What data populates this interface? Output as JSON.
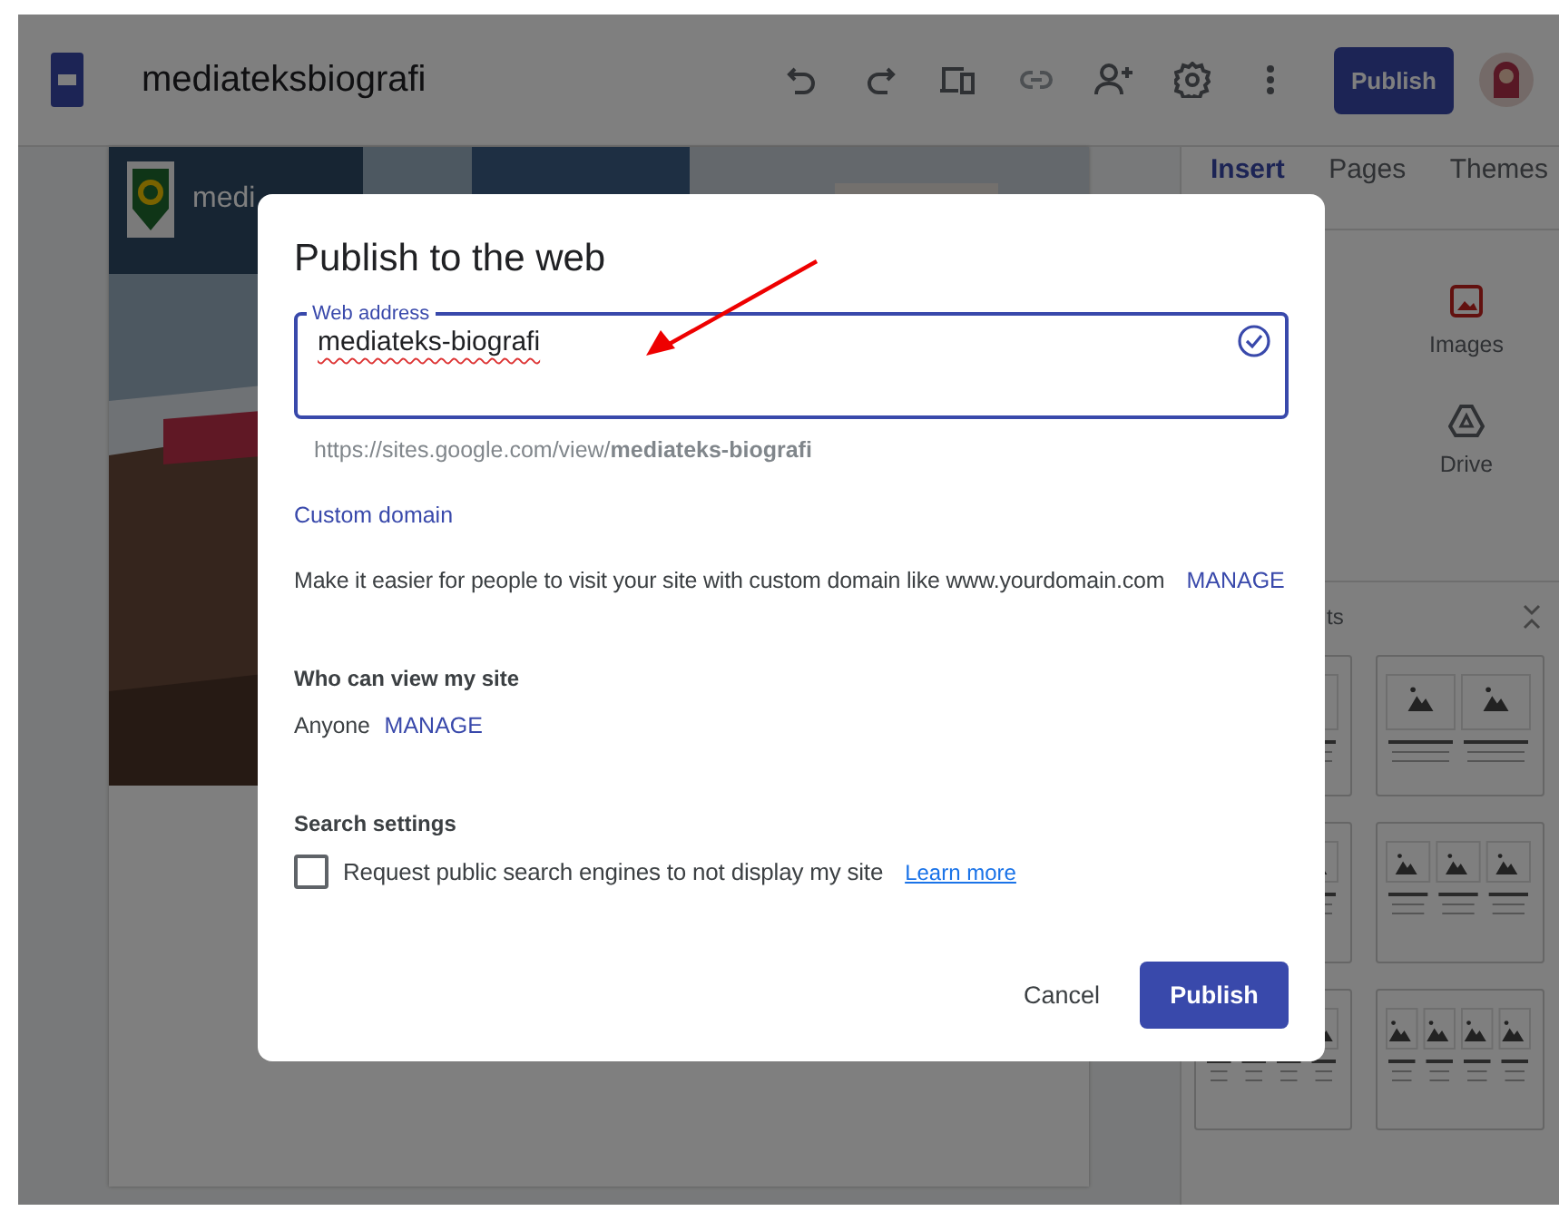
{
  "app": {
    "title": "mediateksbiografi",
    "publish_button": "Publish"
  },
  "site": {
    "title": "medi"
  },
  "sidebar": {
    "tabs": [
      {
        "label": "Insert",
        "selected": true
      },
      {
        "label": "Pages",
        "selected": false
      },
      {
        "label": "Themes",
        "selected": false
      }
    ],
    "items": [
      {
        "kind": "images",
        "label": "Images"
      },
      {
        "kind": "drive",
        "label": "Drive"
      }
    ],
    "section_title": "ts"
  },
  "dialog": {
    "title": "Publish to the web",
    "field": {
      "label": "Web address",
      "value": "mediateks-biografi",
      "valid": true
    },
    "url": "https://sites.google.com/view/**mediateks-biografi**",
    "custom_domain": {
      "heading": "Custom domain",
      "text": "Make it easier for people to visit your site with custom domain like www.yourdomain.com",
      "link": "MANAGE"
    },
    "viewers": {
      "heading": "Who can view my site",
      "value": "Anyone",
      "link": "MANAGE"
    },
    "search": {
      "heading": "Search settings",
      "checkbox": {
        "label": "Request public search engines to not display my site",
        "checked": false
      },
      "link": "Learn more"
    },
    "buttons": {
      "cancel": "Cancel",
      "publish": "Publish"
    }
  }
}
